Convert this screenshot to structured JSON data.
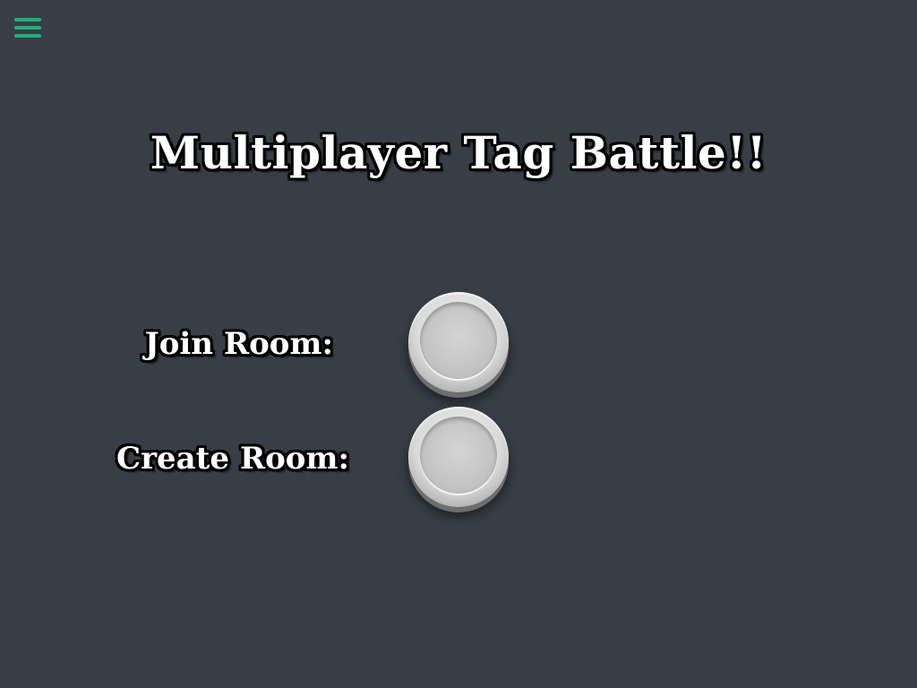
{
  "header": {
    "menu_icon": "hamburger-menu-icon",
    "accent_color": "#1db37d"
  },
  "main": {
    "title": "Multiplayer Tag Battle!!",
    "join": {
      "label": "Join Room:"
    },
    "create": {
      "label": "Create Room:"
    }
  },
  "colors": {
    "background": "#393e46",
    "text": "#ffffff",
    "text_outline": "#000000",
    "button": "#d0d0d0"
  }
}
